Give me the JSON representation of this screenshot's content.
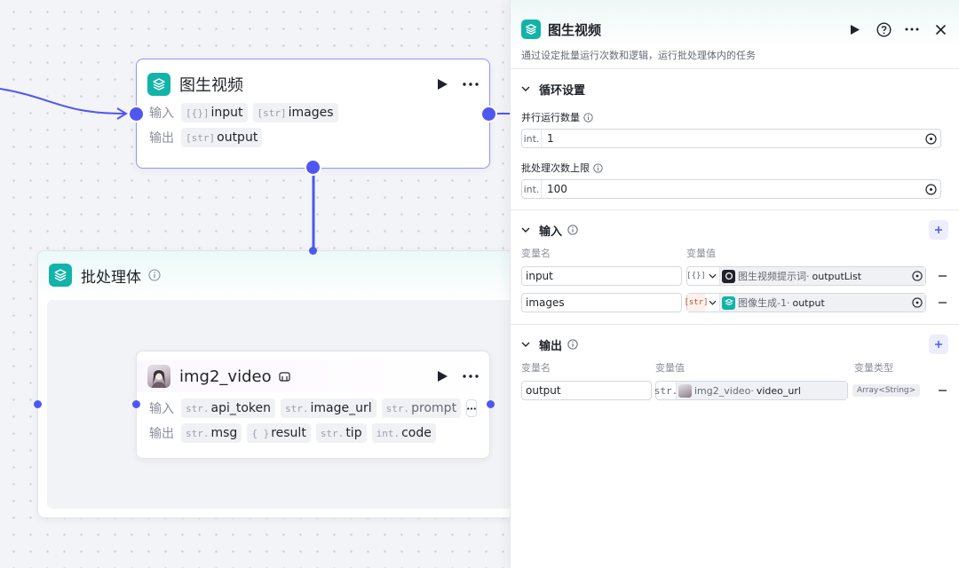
{
  "canvas": {
    "node_main": {
      "title": "图生视频",
      "input_label": "输入",
      "output_label": "输出",
      "inputs": [
        {
          "type": "[{}]",
          "name": "input"
        },
        {
          "type": "[str]",
          "name": "images"
        }
      ],
      "outputs": [
        {
          "type": "[str]",
          "name": "output"
        }
      ]
    },
    "batch": {
      "title": "批处理体"
    },
    "node_sub": {
      "title": "img2_video",
      "input_label": "输入",
      "output_label": "输出",
      "inputs": [
        {
          "type": "str.",
          "name": "api_token"
        },
        {
          "type": "str.",
          "name": "image_url"
        },
        {
          "type": "str.",
          "name": "prompt"
        }
      ],
      "outputs": [
        {
          "type": "str.",
          "name": "msg"
        },
        {
          "type": "{ }",
          "name": "result"
        },
        {
          "type": "str.",
          "name": "tip"
        },
        {
          "type": "int.",
          "name": "code"
        }
      ]
    }
  },
  "panel": {
    "title": "图生视频",
    "description": "通过设定批量运行次数和逻辑，运行批处理体内的任务",
    "loop_section": {
      "title": "循环设置",
      "fields": [
        {
          "label": "并行运行数量",
          "type": "int.",
          "value": "1"
        },
        {
          "label": "批处理次数上限",
          "type": "int.",
          "value": "100"
        }
      ]
    },
    "input_section": {
      "title": "输入",
      "col_name": "变量名",
      "col_value": "变量值",
      "rows": [
        {
          "name": "input",
          "type": "[{}]",
          "source": "图生视频提示词",
          "field": "outputList"
        },
        {
          "name": "images",
          "type": "[str]",
          "source": "图像生成-1",
          "field": "output"
        }
      ]
    },
    "output_section": {
      "title": "输出",
      "col_name": "变量名",
      "col_value": "变量值",
      "col_type": "变量类型",
      "rows": [
        {
          "name": "output",
          "type": "str.",
          "source": "img2_video",
          "field": "video_url",
          "var_type": "Array<String>"
        }
      ]
    }
  },
  "colors": {
    "accent": "#4f57f2",
    "brand_teal": "#12b3a8",
    "ref_orange": "#b0532c"
  }
}
